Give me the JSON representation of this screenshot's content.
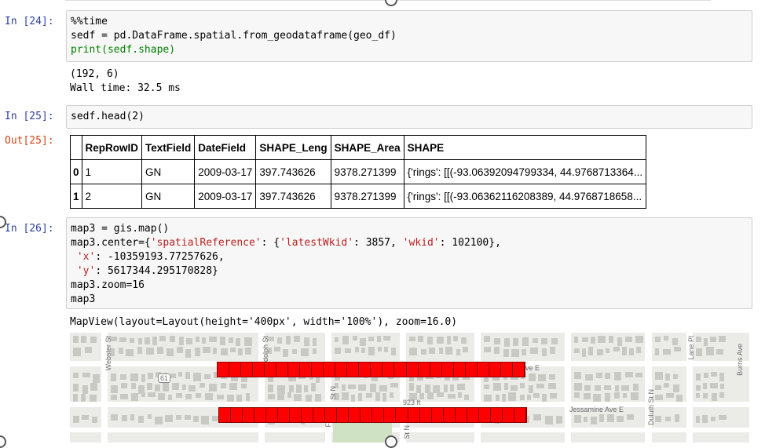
{
  "cells": [
    {
      "prompt": "In [24]:",
      "code_lines": [
        "%%time",
        "sedf = pd.DataFrame.spatial.from_geodataframe(geo_df)",
        "print(sedf.shape)"
      ],
      "output_lines": [
        "(192, 6)",
        "Wall time: 32.5 ms"
      ]
    },
    {
      "prompt": "In [25]:",
      "code_lines": [
        "sedf.head(2)"
      ],
      "out_prompt": "Out[25]:"
    },
    {
      "prompt": "In [26]:",
      "code_lines": [
        "map3 = gis.map()",
        "map3.center={'spatialReference': {'latestWkid': 3857, 'wkid': 102100},",
        " 'x': -10359193.77257626,",
        " 'y': 5617344.295170828}",
        "map3.zoom=16",
        "map3"
      ],
      "output_lines": [
        "MapView(layout=Layout(height='400px', width='100%'), zoom=16.0)"
      ]
    }
  ],
  "table": {
    "columns": [
      "",
      "RepRowID",
      "TextField",
      "DateField",
      "SHAPE_Leng",
      "SHAPE_Area",
      "SHAPE"
    ],
    "rows": [
      [
        "0",
        "1",
        "GN",
        "2009-03-17",
        "397.743626",
        "9378.271399",
        "{'rings': [[(-93.06392094799334, 44.9768713364..."
      ],
      [
        "1",
        "2",
        "GN",
        "2009-03-17",
        "397.743626",
        "9378.271399",
        "{'rings': [[(-93.06362116208389, 44.9768718658..."
      ]
    ]
  },
  "map_labels": {
    "webster": "Webster St",
    "randolph": "Randolph St",
    "hwy": "61",
    "ave_e": "ve E",
    "n923": "923 ft",
    "st_n1": "St N",
    "st_n2": "St N",
    "jessamine": "Jessamine Ave E",
    "duluth": "Duluth St N",
    "lane": "Lane Pl",
    "burns": "Burns Ave",
    "fo": "Fo"
  },
  "colors": {
    "in_prompt": "#303f9f",
    "out_prompt": "#d84315",
    "polygon_fill": "#ff0000"
  }
}
